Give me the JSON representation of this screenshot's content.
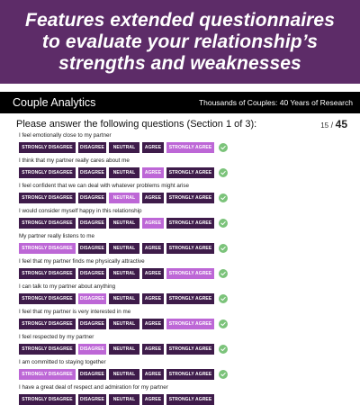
{
  "banner": {
    "line1": "Features extended questionnaires",
    "line2": "to evaluate your relationship’s",
    "line3": "strengths and weaknesses"
  },
  "app": {
    "title": "Couple Analytics",
    "tagline": "Thousands of Couples: 40 Years of Research"
  },
  "section": {
    "instruction": "Please answer the following questions (Section 1 of 3):",
    "current": "15",
    "separator": " / ",
    "total": "45"
  },
  "options": [
    "STRONGLY DISAGREE",
    "DISAGREE",
    "NEUTRAL",
    "AGREE",
    "STRONGLY AGREE"
  ],
  "questions": [
    {
      "text": "I feel emotionally close to my partner",
      "selected": 4
    },
    {
      "text": "I think that my partner really cares about me",
      "selected": 3
    },
    {
      "text": "I feel confident that we can deal with whatever problems might arise",
      "selected": 2
    },
    {
      "text": "I would consider myself happy in this relationship",
      "selected": 3
    },
    {
      "text": "My partner really listens to me",
      "selected": 0
    },
    {
      "text": "I feel that my partner finds me physically attractive",
      "selected": 4
    },
    {
      "text": "I can talk to my partner about anything",
      "selected": 1
    },
    {
      "text": "I feel that my partner is very interested in me",
      "selected": 4
    },
    {
      "text": "I feel respected by my partner",
      "selected": 1
    },
    {
      "text": "I am committed to staying together",
      "selected": 0
    },
    {
      "text": "I have a great deal of respect and admiration for my partner",
      "selected": null
    }
  ],
  "colors": {
    "banner": "#5d2c68",
    "button": "#3e1b4a",
    "selected": "#bd67d6",
    "check": "#7bc37a"
  }
}
